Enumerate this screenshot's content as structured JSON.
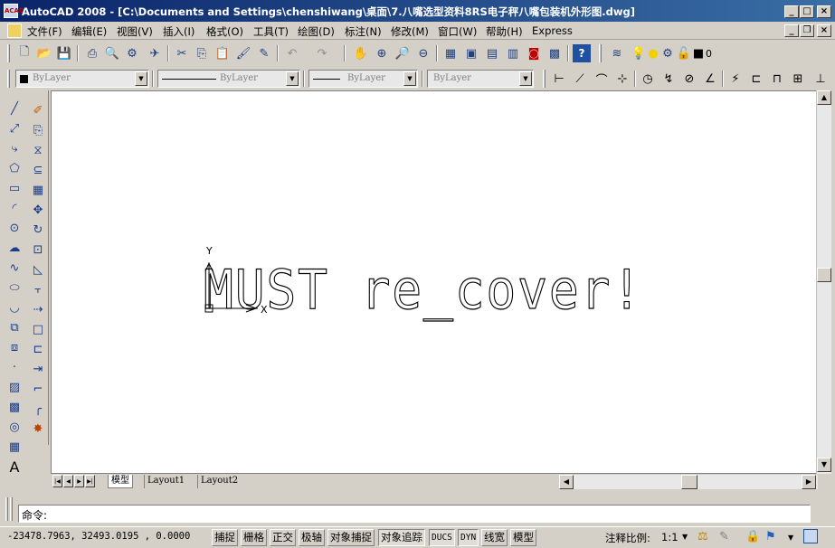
{
  "window": {
    "title": "AutoCAD 2008 - [C:\\Documents and Settings\\chenshiwang\\桌面\\7.八嘴选型资料8RS电子秤八嘴包装机外形图.dwg]",
    "app_icon_text": "ACAD"
  },
  "menu": {
    "items": [
      "文件(F)",
      "编辑(E)",
      "视图(V)",
      "插入(I)",
      "格式(O)",
      "工具(T)",
      "绘图(D)",
      "标注(N)",
      "修改(M)",
      "窗口(W)",
      "帮助(H)",
      "Express"
    ]
  },
  "properties_toolbar": {
    "color": "ByLayer",
    "linetype": "ByLayer",
    "lineweight": "ByLayer",
    "plotstyle": "ByLayer"
  },
  "layer": {
    "current": "0"
  },
  "canvas": {
    "drawing_text": "MUST re_cover!",
    "ucs_y_label": "Y",
    "ucs_x_label": "X"
  },
  "tabs": [
    "模型",
    "Layout1",
    "Layout2"
  ],
  "command": {
    "prompt": "命令:",
    "value": ""
  },
  "status": {
    "coordinates": "-23478.7963, 32493.0195 , 0.0000",
    "toggles": [
      {
        "label": "捕捉",
        "on": false
      },
      {
        "label": "栅格",
        "on": false
      },
      {
        "label": "正交",
        "on": false
      },
      {
        "label": "极轴",
        "on": false
      },
      {
        "label": "对象捕捉",
        "on": false
      },
      {
        "label": "对象追踪",
        "on": true
      },
      {
        "label": "DUCS",
        "on": true
      },
      {
        "label": "DYN",
        "on": true
      },
      {
        "label": "线宽",
        "on": false
      },
      {
        "label": "模型",
        "on": false
      }
    ],
    "annotation_scale_label": "注释比例:",
    "annotation_scale_value": "1:1"
  }
}
